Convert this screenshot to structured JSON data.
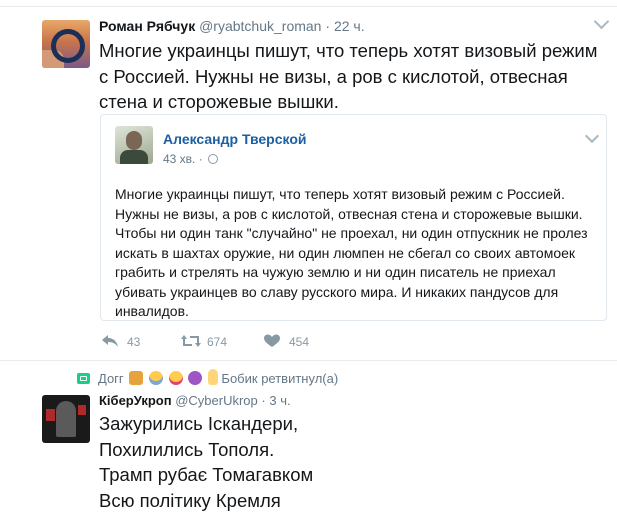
{
  "tweet": {
    "author_name": "Роман Рябчук",
    "author_handle": "@ryabtchuk_roman",
    "separator": "·",
    "time": "22 ч.",
    "text": "Многие украинцы пишут, что теперь хотят визовый режим с Россией. Нужны не визы, а ров с кислотой, отвесная стена и сторожевые вышки.",
    "quoted": {
      "author_name": "Александр Тверской",
      "time": "43 хв.",
      "separator": "·",
      "text": "Многие украинцы пишут, что теперь хотят визовый режим с Россией. Нужны не визы, а ров с кислотой, отвесная стена и сторожевые вышки. Чтобы ни один танк \"случайно\" не проехал, ни один отпускник не пролез искать в шахтах оружие, ни один люмпен не сбегал со своих автомоек грабить и стрелять на чужую землю и ни один писатель не приехал убивать украинцев во славу русского мира. И никаких пандусов для инвалидов."
    },
    "actions": {
      "reply_count": "43",
      "retweet_count": "674",
      "like_count": "454"
    }
  },
  "retweet_context": {
    "prefix": "Догг",
    "suffix": "Бобик ретвитнул(а)",
    "emojis": [
      "dog-emoji",
      "scream-emoji",
      "tongue-emoji",
      "devil-emoji",
      "victory-hand-emoji"
    ]
  },
  "tweet2": {
    "author_name": "КіберУкроп",
    "author_handle": "@CyberUkrop",
    "separator": "·",
    "time": "3 ч.",
    "lines": [
      "Зажурились Іскандери,",
      "Похилились Тополя.",
      "Трамп рубає Томагавком",
      "Всю політику Кремля"
    ]
  },
  "colors": {
    "accent_blue": "#1b5ea1",
    "retweet_green": "#19cf86",
    "muted": "#657786"
  }
}
